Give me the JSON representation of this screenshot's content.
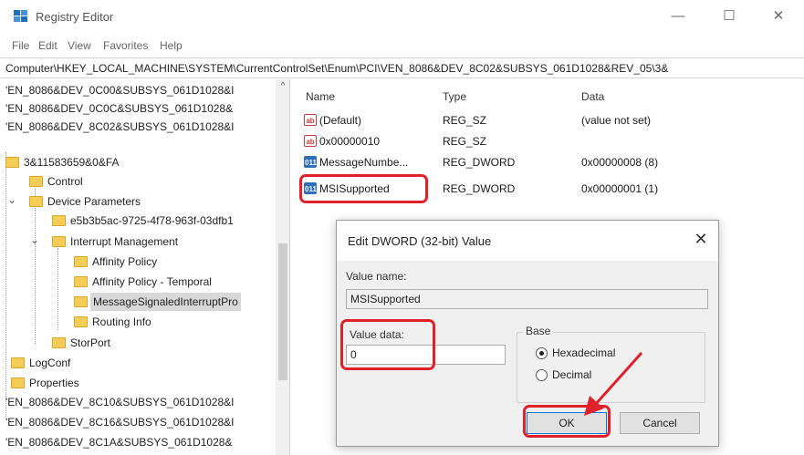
{
  "window": {
    "title": "Registry Editor",
    "minimize": "—",
    "maximize": "☐",
    "close": "✕"
  },
  "menu": [
    "File",
    "Edit",
    "View",
    "Favorites",
    "Help"
  ],
  "address": "Computer\\HKEY_LOCAL_MACHINE\\SYSTEM\\CurrentControlSet\\Enum\\PCI\\VEN_8086&DEV_8C02&SUBSYS_061D1028&REV_05\\3&",
  "tree": [
    {
      "label": "'EN_8086&DEV_0C00&SUBSYS_061D1028&I"
    },
    {
      "label": "'EN_8086&DEV_0C0C&SUBSYS_061D1028&"
    },
    {
      "label": "'EN_8086&DEV_8C02&SUBSYS_061D1028&I"
    },
    {
      "label": "3&11583659&0&FA"
    },
    {
      "label": "Control"
    },
    {
      "label": "Device Parameters"
    },
    {
      "label": "e5b3b5ac-9725-4f78-963f-03dfb1"
    },
    {
      "label": "Interrupt Management"
    },
    {
      "label": "Affinity Policy"
    },
    {
      "label": "Affinity Policy - Temporal"
    },
    {
      "label": "MessageSignaledInterruptPro"
    },
    {
      "label": "Routing Info"
    },
    {
      "label": "StorPort"
    },
    {
      "label": "LogConf"
    },
    {
      "label": "Properties"
    },
    {
      "label": "'EN_8086&DEV_8C10&SUBSYS_061D1028&I"
    },
    {
      "label": "'EN_8086&DEV_8C16&SUBSYS_061D1028&I"
    },
    {
      "label": "'EN_8086&DEV_8C1A&SUBSYS_061D1028&"
    }
  ],
  "tree_arrows": {
    "expand_open": "⌄",
    "expand_closed": "›",
    "scroll_up": "^"
  },
  "list": {
    "headers": {
      "name": "Name",
      "type": "Type",
      "data": "Data"
    },
    "rows": [
      {
        "icon": "string-value-icon",
        "icon_text": "ab",
        "name": "(Default)",
        "type": "REG_SZ",
        "data": "(value not set)"
      },
      {
        "icon": "string-value-icon",
        "icon_text": "ab",
        "name": "0x00000010",
        "type": "REG_SZ",
        "data": ""
      },
      {
        "icon": "dword-value-icon",
        "icon_text": "011",
        "name": "MessageNumbe...",
        "type": "REG_DWORD",
        "data": "0x00000008 (8)"
      },
      {
        "icon": "dword-value-icon",
        "icon_text": "011",
        "name": "MSISupported",
        "type": "REG_DWORD",
        "data": "0x00000001 (1)"
      }
    ]
  },
  "dialog": {
    "title": "Edit DWORD (32-bit) Value",
    "close": "✕",
    "value_name_label": "Value name:",
    "value_name": "MSISupported",
    "value_data_label": "Value data:",
    "value_data": "0",
    "base_label": "Base",
    "radio_hex": "Hexadecimal",
    "radio_dec": "Decimal",
    "selected_base": "Hexadecimal",
    "ok": "OK",
    "cancel": "Cancel"
  },
  "colors": {
    "highlight": "#e0202a",
    "folder": "#f4cd58",
    "accent": "#0078d7"
  }
}
